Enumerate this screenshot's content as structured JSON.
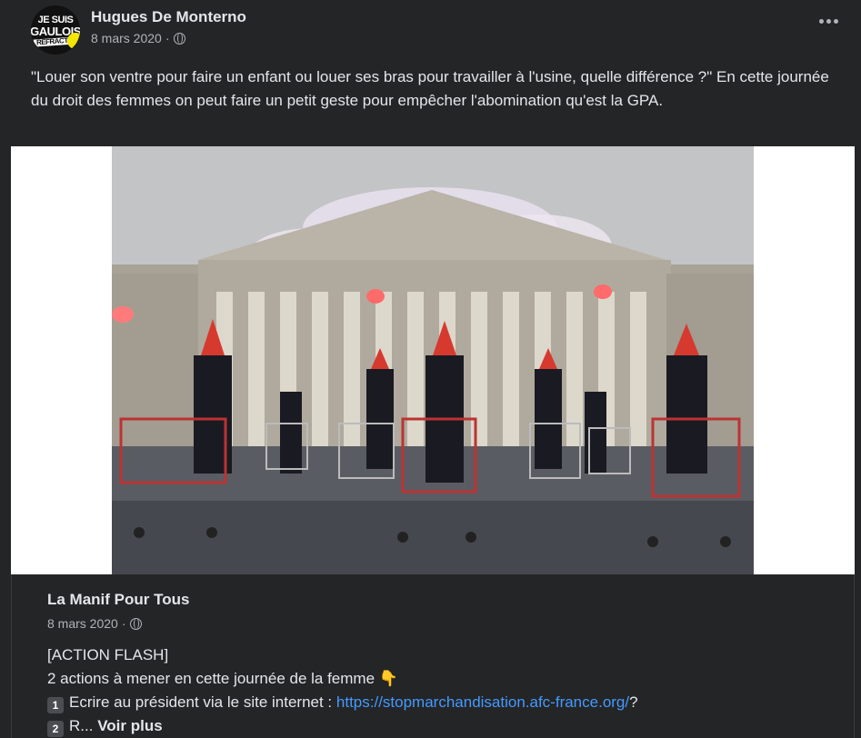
{
  "post": {
    "author": "Hugues De Monterno",
    "date": "8 mars 2020",
    "separator": "·",
    "avatar_text": [
      "JE SUIS",
      "GAULOIS",
      "REFRACTAI"
    ],
    "text": "\"Louer son ventre pour faire un enfant ou louer ses bras pour travailler à l'usine, quelle différence ?\" En cette journée du droit des femmes on peut faire un petit geste pour empêcher l'abomination qu'est la GPA.",
    "privacy_icon": "globe-icon",
    "menu_icon": "more-options-icon"
  },
  "shared": {
    "author": "La Manif Pour Tous",
    "date": "8 mars 2020",
    "separator": "·",
    "line1": "[ACTION FLASH]",
    "line2": "2 actions à mener en cette journée de la femme",
    "line2_emoji": "👇",
    "line3_key": "1",
    "line3_prefix": "Ecrire au président via le site internet :",
    "line3_link": "https://stopmarchandisation.afc-france.org/",
    "line3_suffix": "?",
    "line4_key": "2",
    "line4_prefix": "R...",
    "see_more": "Voir plus"
  },
  "colors": {
    "background": "#242526",
    "text": "#e4e6eb",
    "secondary": "#b0b3b8",
    "link": "#4599ff"
  }
}
